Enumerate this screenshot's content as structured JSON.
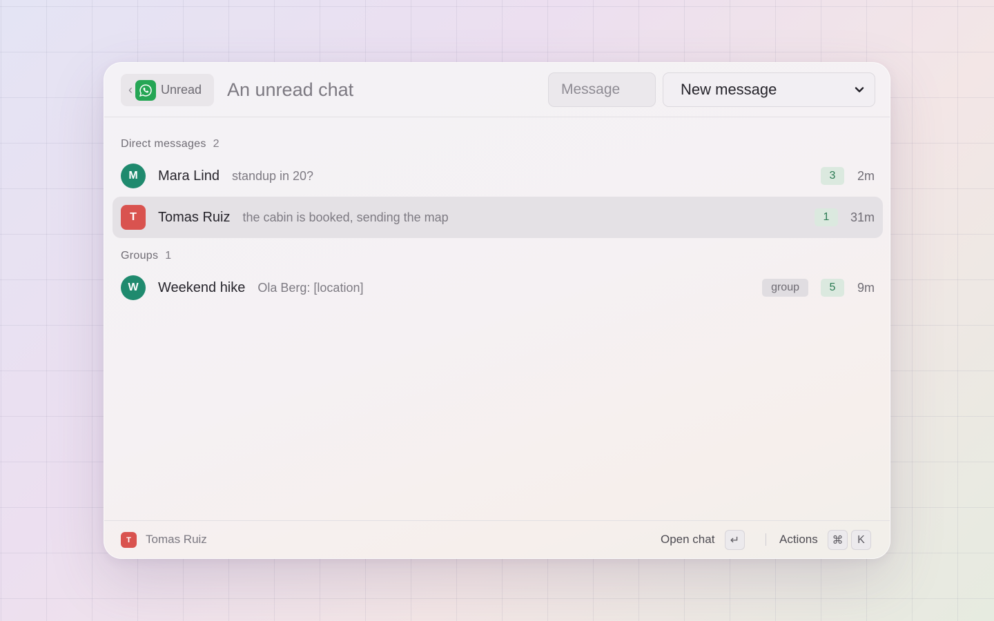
{
  "header": {
    "back_chevron": "‹",
    "back_label": "Unread",
    "app_icon": "whatsapp-icon",
    "title": "An unread chat",
    "message_placeholder": "Message",
    "action_value": "New message"
  },
  "sections": {
    "direct": {
      "label": "Direct messages",
      "count": "2"
    },
    "groups": {
      "label": "Groups",
      "count": "1"
    }
  },
  "chats": [
    {
      "initial": "M",
      "name": "Mara Lind",
      "preview": "standup in 20?",
      "unread": "3",
      "time": "2m",
      "avatar_color": "#1f8a6e"
    },
    {
      "initial": "T",
      "name": "Tomas Ruiz",
      "preview": "the cabin is booked, sending the map",
      "unread": "1",
      "time": "31m",
      "avatar_color": "#d9534f"
    },
    {
      "initial": "W",
      "name": "Weekend hike",
      "preview": "Ola Berg: [location]",
      "tag": "group",
      "unread": "5",
      "time": "9m",
      "avatar_color": "#1f8a6e"
    }
  ],
  "footer": {
    "selected_initial": "T",
    "selected_name": "Tomas Ruiz",
    "primary_action": "Open chat",
    "primary_key": "↵",
    "secondary_action": "Actions",
    "secondary_key_mod": "⌘",
    "secondary_key": "K"
  },
  "colors": {
    "accent_green": "#25a655",
    "unread_badge_bg": "#dbe9df",
    "unread_badge_text": "#2a7a52",
    "selection_bg": "#e4e1e5"
  }
}
